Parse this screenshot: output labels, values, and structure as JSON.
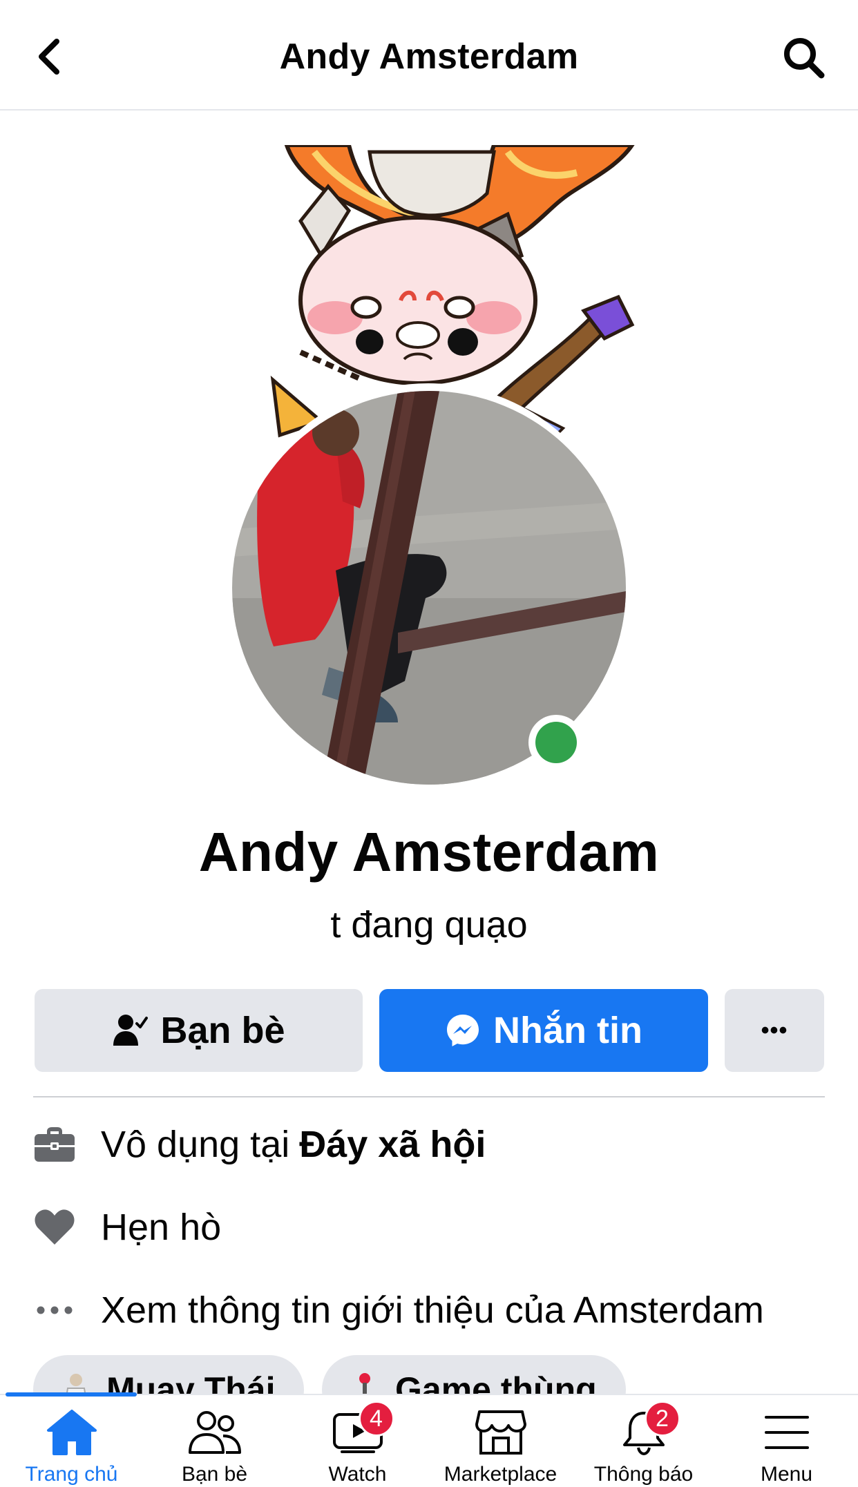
{
  "header": {
    "title": "Andy Amsterdam"
  },
  "profile": {
    "name": "Andy Amsterdam",
    "bio": "t đang quạo",
    "online": true
  },
  "actions": {
    "friends_label": "Bạn bè",
    "message_label": "Nhắn tin",
    "more_label": "•••"
  },
  "info": {
    "work_prefix": "Vô dụng tại",
    "work_place": "Đáy xã hội",
    "dating_label": "Hẹn hò",
    "about_label": "Xem thông tin giới thiệu của Amsterdam"
  },
  "chips": [
    {
      "label": "Muay Thái",
      "icon": "martial-arts-icon"
    },
    {
      "label": "Game thùng",
      "icon": "joystick-icon"
    }
  ],
  "bottom_nav": {
    "items": [
      {
        "label": "Trang chủ",
        "icon": "home-icon",
        "active": true
      },
      {
        "label": "Bạn bè",
        "icon": "friends-icon"
      },
      {
        "label": "Watch",
        "icon": "watch-icon",
        "badge": "4"
      },
      {
        "label": "Marketplace",
        "icon": "marketplace-icon"
      },
      {
        "label": "Thông báo",
        "icon": "bell-icon",
        "badge": "2"
      },
      {
        "label": "Menu",
        "icon": "menu-icon"
      }
    ]
  },
  "colors": {
    "accent": "#1877f2",
    "button_gray": "#e4e6eb",
    "online_green": "#31a24c",
    "badge_red": "#e41e3f"
  }
}
